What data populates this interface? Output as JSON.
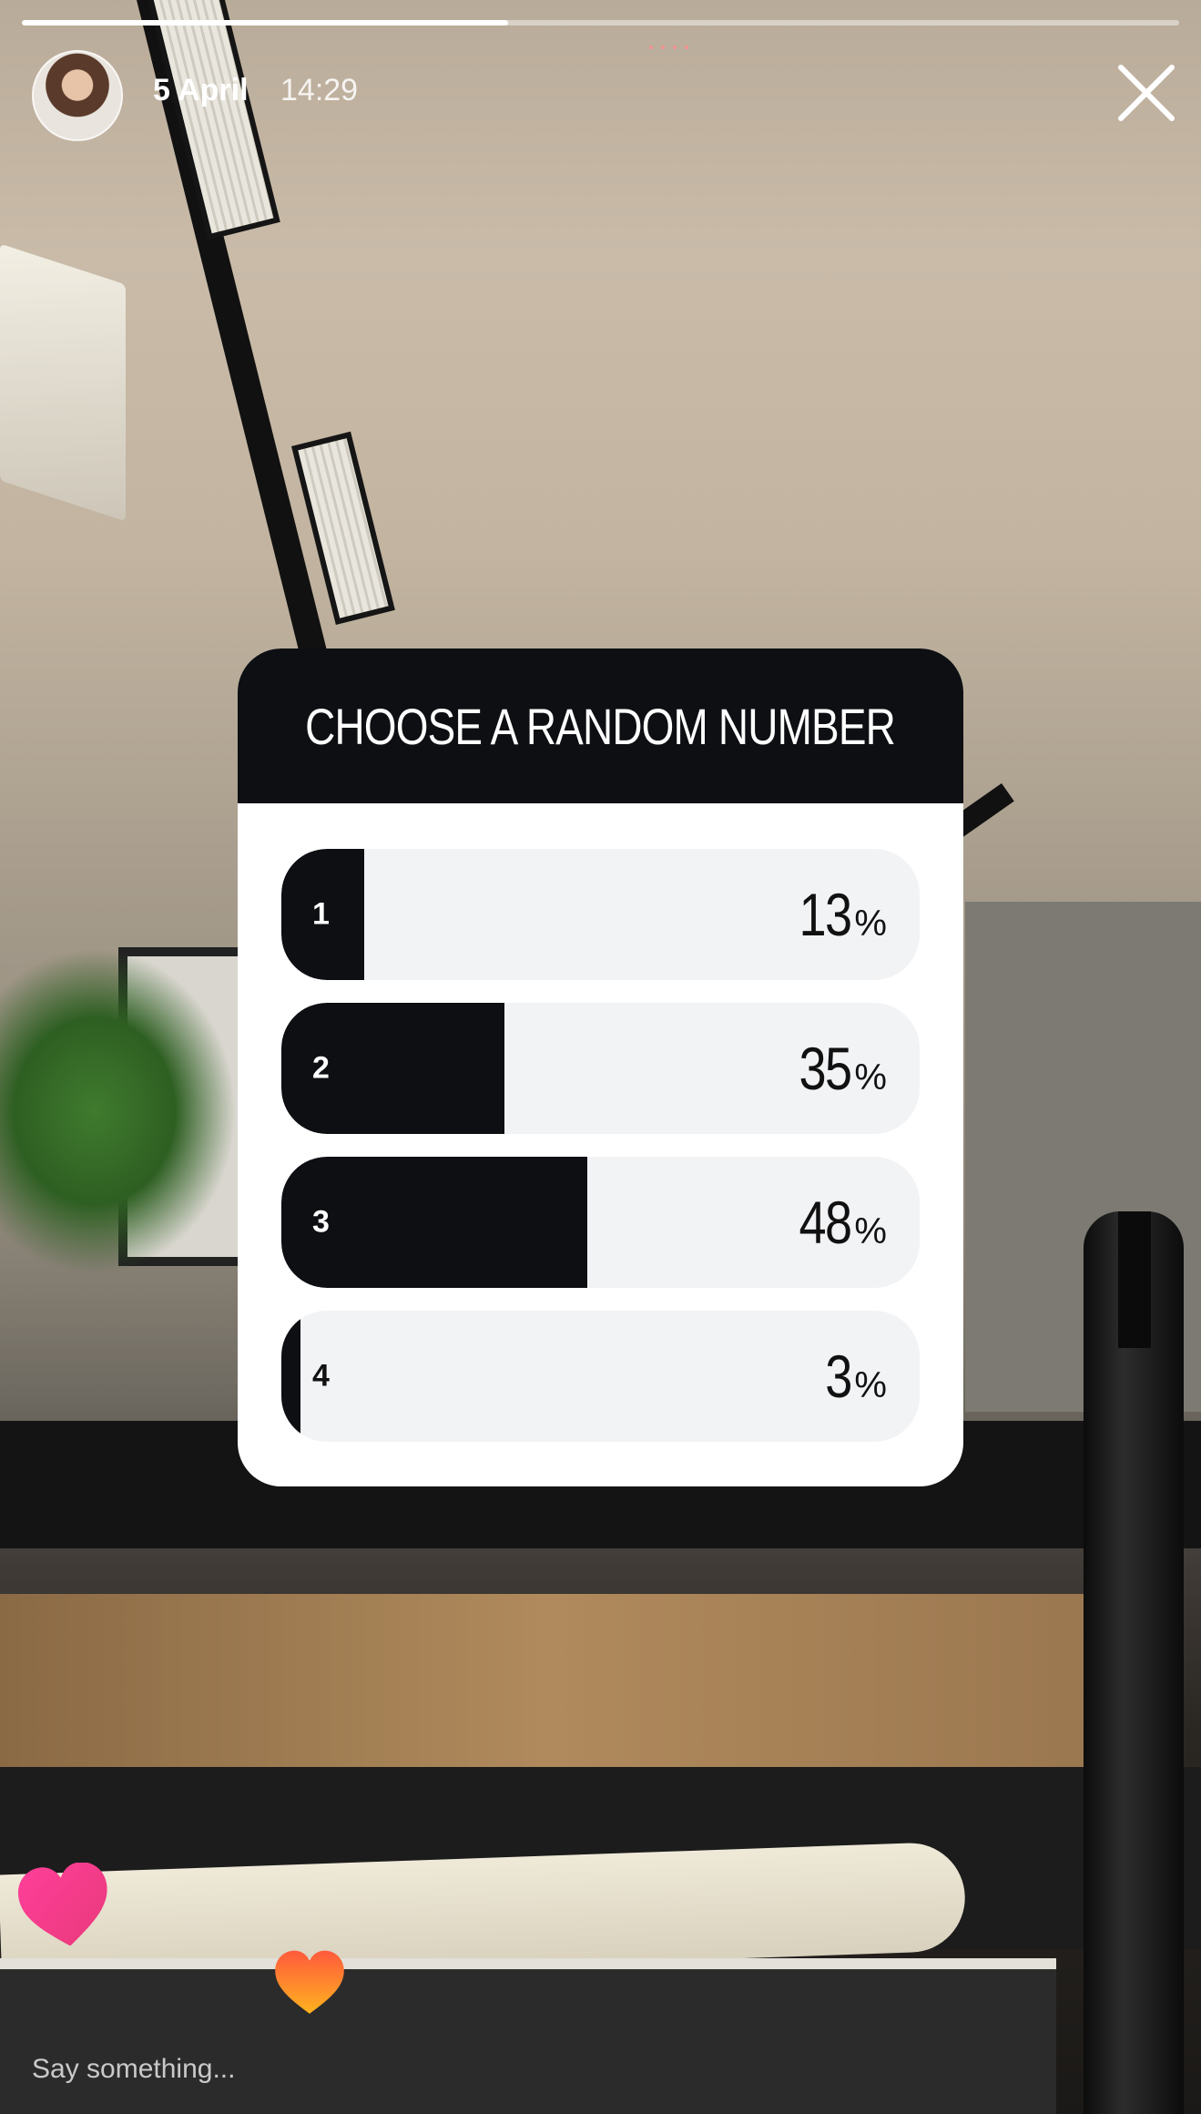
{
  "story": {
    "date": "5 April",
    "time": "14:29",
    "progress": 0.42
  },
  "poll": {
    "question": "CHOOSE A RANDOM NUMBER",
    "options": [
      {
        "label": "1",
        "percent": "13",
        "value": 13
      },
      {
        "label": "2",
        "percent": "35",
        "value": 35
      },
      {
        "label": "3",
        "percent": "48",
        "value": 48
      },
      {
        "label": "4",
        "percent": "3",
        "value": 3
      }
    ],
    "percent_symbol": "%"
  },
  "reply": {
    "placeholder": "Say something..."
  },
  "colors": {
    "poll_dark": "#0d0f13",
    "poll_track": "#f2f3f5",
    "heart_gradient_start": "#ff3f9a",
    "heart_gradient_end": "#ffb21f"
  },
  "icons": {
    "close": "close-icon",
    "heart": "heart-icon",
    "menu": "more-dots-icon"
  }
}
